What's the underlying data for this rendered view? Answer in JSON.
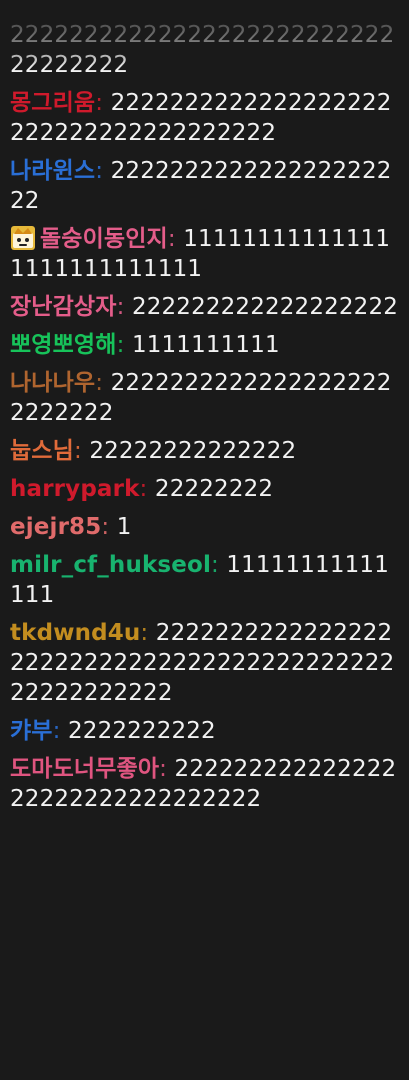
{
  "messages": [
    {
      "nick": "",
      "text": "2222222222222222222222222222222222"
    },
    {
      "nick": "몽그리움",
      "text": "2222222222222222222222222222222222222",
      "nick_color": "#d01a2c"
    },
    {
      "nick": "나라윈스",
      "text": "222222222222222222222",
      "nick_color": "#2a6fd6"
    },
    {
      "nick": "돌숭이동인지",
      "text": "111111111111111111111111111",
      "nick_color": "#e45d8a",
      "badge": "crown-face-icon"
    },
    {
      "nick": "장난감상자",
      "text": "222222222222222222",
      "nick_color": "#e45d8a"
    },
    {
      "nick": "뽀영뽀영해",
      "text": "1111111111",
      "nick_color": "#17c35a"
    },
    {
      "nick": "나나나우",
      "text": "22222222222222222222222222",
      "nick_color": "#b0652f"
    },
    {
      "nick": "눕스님",
      "text": "22222222222222",
      "nick_color": "#e06b3a"
    },
    {
      "nick": "harrypark",
      "text": "22222222",
      "nick_color": "#d01a2c"
    },
    {
      "nick": "ejejr85",
      "text": "1",
      "nick_color": "#e06b6b"
    },
    {
      "nick": "milr_cf_hukseol",
      "text": "11111111111111",
      "nick_color": "#18b36f"
    },
    {
      "nick": "tkdwnd4u",
      "text": "22222222222222222222222222222222222222222222222222222",
      "nick_color": "#c38d1f"
    },
    {
      "nick": "캬부",
      "text": "2222222222",
      "nick_color": "#2a6fd6"
    },
    {
      "nick": "도마도너무좋아",
      "text": "22222222222222222222222222222222",
      "nick_color": "#e05580"
    }
  ]
}
